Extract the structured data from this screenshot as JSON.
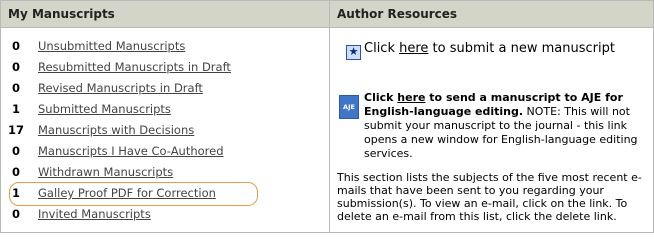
{
  "left_panel": {
    "title": "My Manuscripts",
    "items": [
      {
        "count": "0",
        "label": "Unsubmitted Manuscripts"
      },
      {
        "count": "0",
        "label": "Resubmitted Manuscripts in Draft"
      },
      {
        "count": "0",
        "label": "Revised Manuscripts in Draft"
      },
      {
        "count": "1",
        "label": "Submitted Manuscripts"
      },
      {
        "count": "17",
        "label": "Manuscripts with Decisions"
      },
      {
        "count": "0",
        "label": "Manuscripts I Have Co-Authored"
      },
      {
        "count": "0",
        "label": "Withdrawn Manuscripts"
      },
      {
        "count": "1",
        "label": "Galley Proof PDF for Correction"
      },
      {
        "count": "0",
        "label": "Invited Manuscripts"
      }
    ]
  },
  "right_panel": {
    "title": "Author Resources",
    "submit": {
      "prefix": "Click ",
      "link": "here",
      "suffix": " to submit a new manuscript"
    },
    "aje": {
      "icon_label": "AJE",
      "prefix": "Click ",
      "link": "here",
      "bold_suffix": " to send a manuscript to AJE for English-language editing.",
      "note": " NOTE: This will not submit your manuscript to the journal - this link opens a new window for English-language editing services."
    },
    "emails_note": "This section lists the subjects of the five most recent e-mails that have been sent to you regarding your submission(s). To view an e-mail, click on the link. To delete an e-mail from this list, click the delete link."
  },
  "colors": {
    "header_bg": "#d4d5c9",
    "border": "#b9b9b9",
    "highlight": "#e39b4a"
  }
}
